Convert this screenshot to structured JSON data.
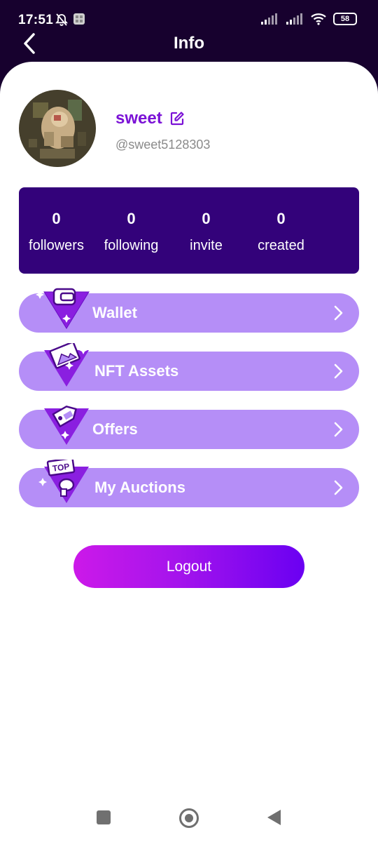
{
  "status": {
    "time": "17:51",
    "battery": "58"
  },
  "header": {
    "title": "Info"
  },
  "profile": {
    "name": "sweet",
    "handle": "@sweet5128303"
  },
  "stats": [
    {
      "value": "0",
      "label": "followers"
    },
    {
      "value": "0",
      "label": "following"
    },
    {
      "value": "0",
      "label": "invite"
    },
    {
      "value": "0",
      "label": "created"
    }
  ],
  "menu": [
    {
      "label": "Wallet",
      "icon": "wallet-icon"
    },
    {
      "label": "NFT Assets",
      "icon": "nft-image-icon"
    },
    {
      "label": "Offers",
      "icon": "price-tag-icon"
    },
    {
      "label": "My Auctions",
      "icon": "top-auction-icon"
    }
  ],
  "logout": {
    "label": "Logout"
  },
  "top_badge": "TOP",
  "colors": {
    "header_bg": "#17012e",
    "accent": "#7b12d6",
    "stats_bg": "#33027a",
    "menu_bg": "#b58ef7",
    "logout_start": "#cc19e9",
    "logout_end": "#6a00f2"
  }
}
